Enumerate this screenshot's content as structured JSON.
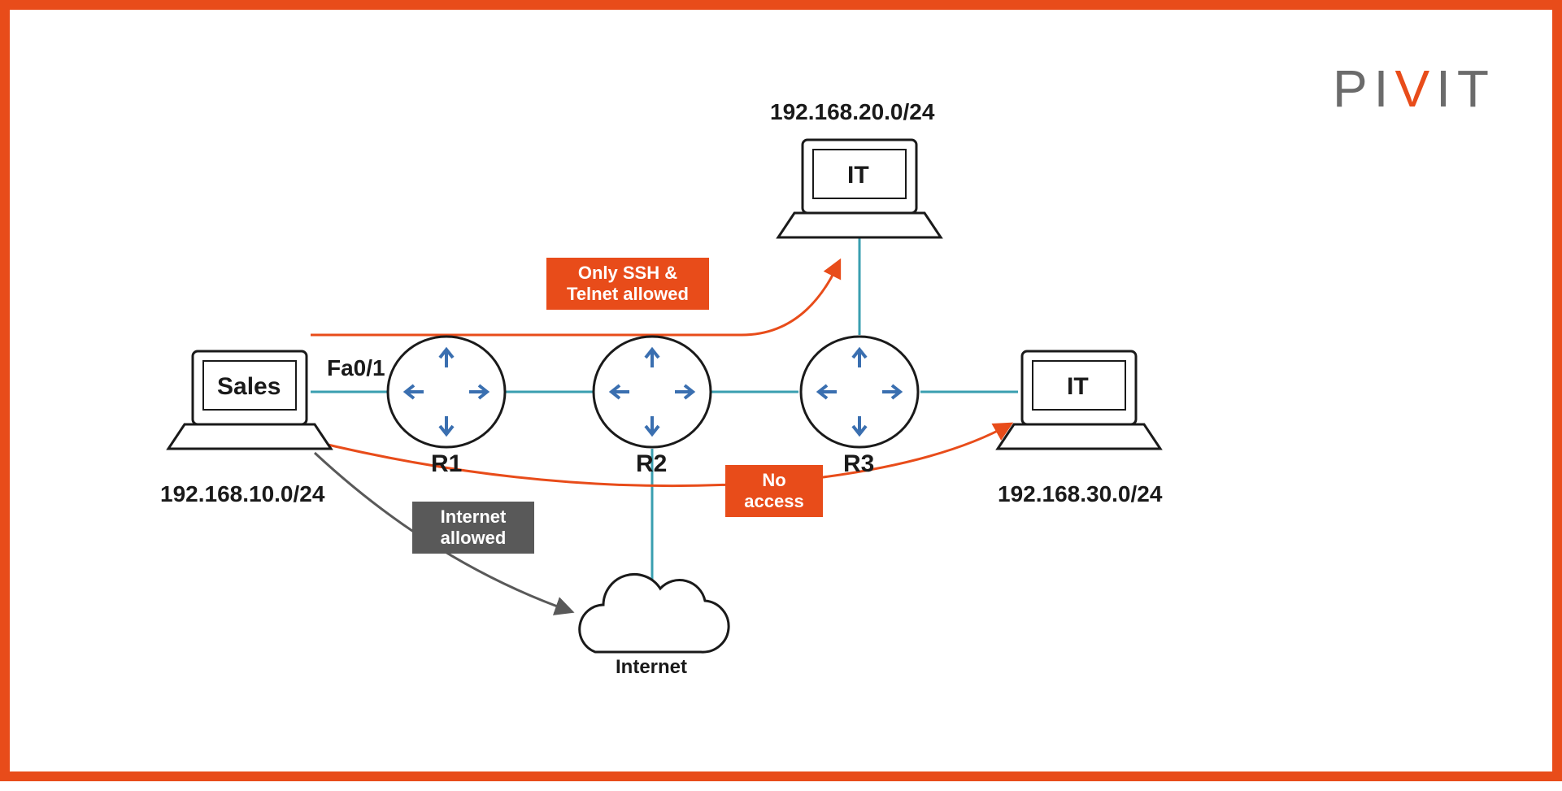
{
  "logo": {
    "p1": "PI",
    "accent": "V",
    "p2": "IT"
  },
  "subnets": {
    "sales": "192.168.10.0/24",
    "it_top": "192.168.20.0/24",
    "it_right": "192.168.30.0/24"
  },
  "devices": {
    "sales": "Sales",
    "it_top": "IT",
    "it_right": "IT",
    "r1": "R1",
    "r2": "R2",
    "r3": "R3",
    "internet": "Internet"
  },
  "interfaces": {
    "fa01": "Fa0/1"
  },
  "rules": {
    "ssh_telnet": "Only SSH &\nTelnet allowed",
    "no_access": "No\naccess",
    "internet_allowed": "Internet\nallowed"
  }
}
